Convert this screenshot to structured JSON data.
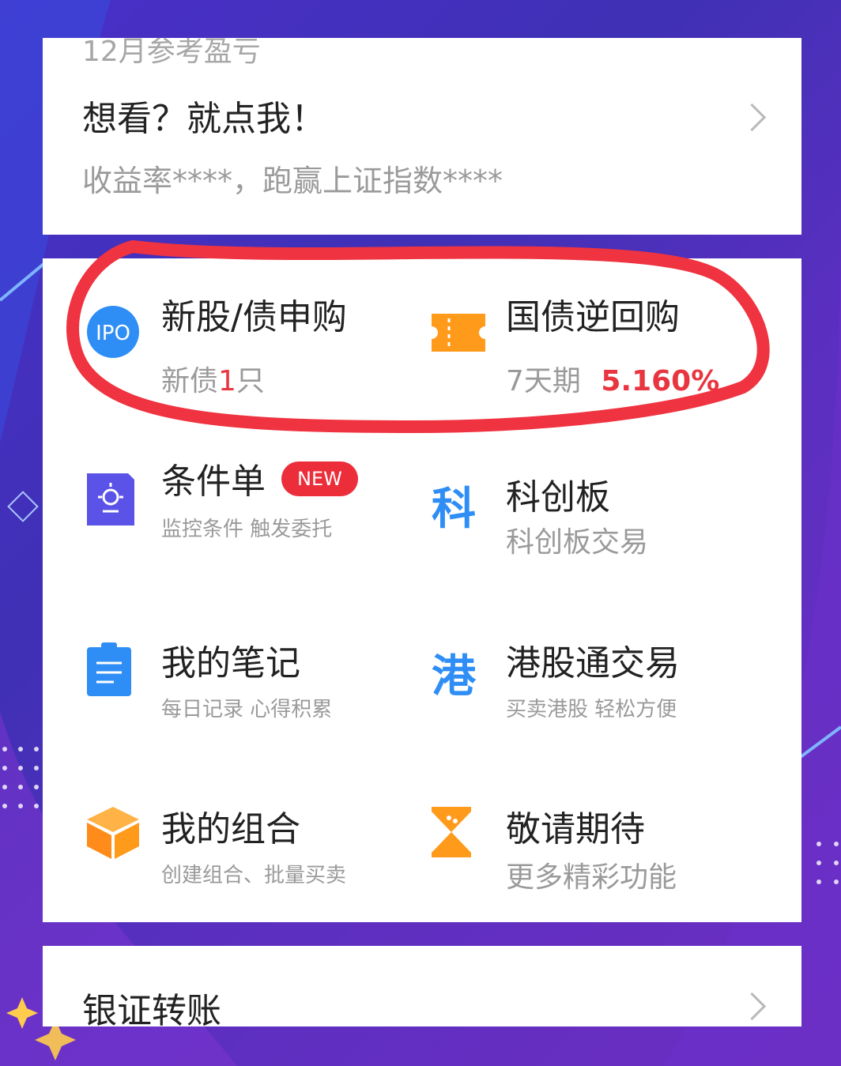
{
  "top_card": {
    "header_label": "12月参考盈亏",
    "headline": "想看？就点我！",
    "summary": "收益率****，跑赢上证指数****"
  },
  "grid": {
    "ipo": {
      "icon_text": "IPO",
      "title": "新股/债申购",
      "sub_prefix": "新债",
      "sub_count": "1",
      "sub_suffix": "只"
    },
    "repo": {
      "title": "国债逆回购",
      "sub_term": "7天期",
      "sub_rate": "5.160%"
    },
    "conditional": {
      "title": "条件单",
      "badge": "NEW",
      "sub": "监控条件 触发委托"
    },
    "star_market": {
      "icon_char": "科",
      "title": "科创板",
      "sub": "科创板交易"
    },
    "notes": {
      "title": "我的笔记",
      "sub": "每日记录 心得积累"
    },
    "hk_connect": {
      "icon_char": "港",
      "title": "港股通交易",
      "sub": "买卖港股 轻松方便"
    },
    "portfolio": {
      "title": "我的组合",
      "sub": "创建组合、批量买卖"
    },
    "coming_soon": {
      "title": "敬请期待",
      "sub": "更多精彩功能"
    }
  },
  "bottom_card": {
    "title": "银证转账"
  },
  "colors": {
    "accent_red": "#e8353f",
    "blue": "#2f8ef6",
    "orange": "#ff9a1a",
    "purple": "#5b52e8"
  }
}
